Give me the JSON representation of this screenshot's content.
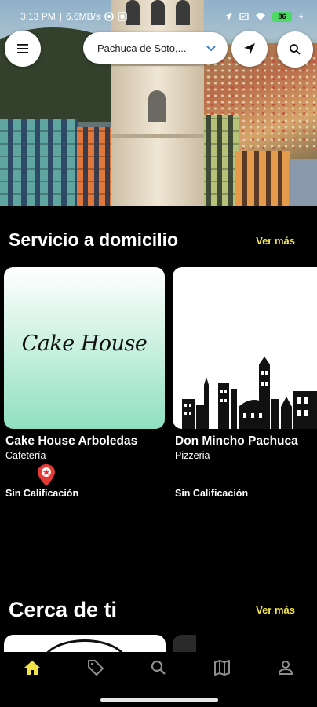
{
  "status_bar": {
    "time": "3:13 PM",
    "speed": "6.6MB/s",
    "battery": "86"
  },
  "header": {
    "location": "Pachuca de Soto,...",
    "menu_icon": "hamburger-menu-icon",
    "location_icon": "navigation-arrow-icon",
    "search_icon": "search-icon"
  },
  "delivery_section": {
    "title": "Servicio a domicilio",
    "see_more": "Ver más",
    "cards": [
      {
        "logo_text": "Cake House",
        "name": "Cake House Arboledas",
        "category": "Cafetería",
        "rating": "Sin Calificación"
      },
      {
        "name": "Don Mincho Pachuca",
        "category": "Pizzeria",
        "rating": "Sin Calificación"
      }
    ]
  },
  "nearby_section": {
    "title": "Cerca de ti",
    "see_more": "Ver más"
  },
  "bottom_nav": {
    "items": [
      "home-icon",
      "tag-icon",
      "search-icon",
      "map-icon",
      "profile-icon"
    ],
    "active_color": "#f2e24a",
    "inactive_color": "#8e8e8e"
  },
  "colors": {
    "accent": "#f2e24a",
    "pin": "#e53935"
  }
}
